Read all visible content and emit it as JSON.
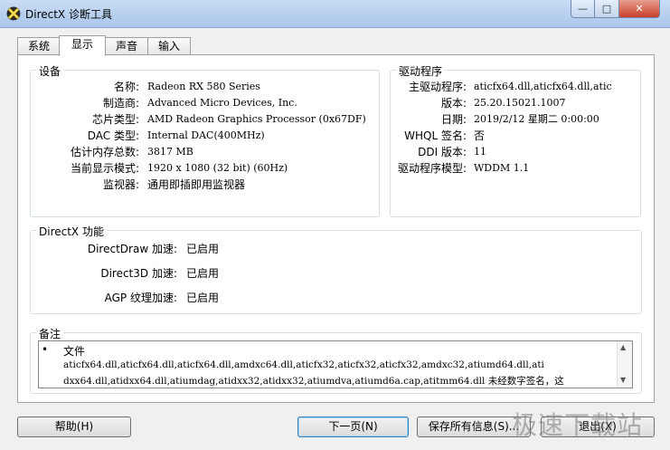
{
  "window": {
    "title": "DirectX 诊断工具",
    "buttons": {
      "min": "—",
      "max": "□",
      "close": "✕"
    }
  },
  "tabs": [
    {
      "label": "系统",
      "active": false
    },
    {
      "label": "显示",
      "active": true
    },
    {
      "label": "声音",
      "active": false
    },
    {
      "label": "输入",
      "active": false
    }
  ],
  "device": {
    "title": "设备",
    "rows": [
      {
        "label": "名称:",
        "value": "Radeon RX 580 Series"
      },
      {
        "label": "制造商:",
        "value": "Advanced Micro Devices, Inc."
      },
      {
        "label": "芯片类型:",
        "value": "AMD Radeon Graphics Processor (0x67DF)"
      },
      {
        "label": "DAC 类型:",
        "value": "Internal DAC(400MHz)"
      },
      {
        "label": "估计内存总数:",
        "value": "3817 MB"
      },
      {
        "label": "当前显示模式:",
        "value": "1920 x 1080 (32 bit) (60Hz)"
      },
      {
        "label": "监视器:",
        "value": "通用即插即用监视器"
      }
    ]
  },
  "driver": {
    "title": "驱动程序",
    "rows": [
      {
        "label": "主驱动程序:",
        "value": "aticfx64.dll,aticfx64.dll,atic"
      },
      {
        "label": "版本:",
        "value": "25.20.15021.1007"
      },
      {
        "label": "日期:",
        "value": "2019/2/12 星期二 0:00:00"
      },
      {
        "label": "WHQL 签名:",
        "value": "否"
      },
      {
        "label": "DDI 版本:",
        "value": "11"
      },
      {
        "label": "驱动程序模型:",
        "value": "WDDM 1.1"
      }
    ]
  },
  "directx": {
    "title": "DirectX 功能",
    "rows": [
      {
        "label": "DirectDraw 加速:",
        "value": "已启用"
      },
      {
        "label": "Direct3D 加速:",
        "value": "已启用"
      },
      {
        "label": "AGP 纹理加速:",
        "value": "已启用"
      }
    ]
  },
  "notes": {
    "title": "备注",
    "bullet": "•",
    "heading": "文件",
    "line1": "aticfx64.dll,aticfx64.dll,aticfx64.dll,amdxc64.dll,aticfx32,aticfx32,aticfx32,amdxc32,atiumd64.dll,ati",
    "line2": "dxx64.dll,atidxx64.dll,atiumdag,atidxx32,atidxx32,atiumdva,atiumd6a.cap,atitmm64.dll 未经数字签名，这"
  },
  "footer": {
    "help": "帮助(H)",
    "next": "下一页(N)",
    "save": "保存所有信息(S)...",
    "exit": "退出(X)"
  },
  "watermark": "极速下载站"
}
